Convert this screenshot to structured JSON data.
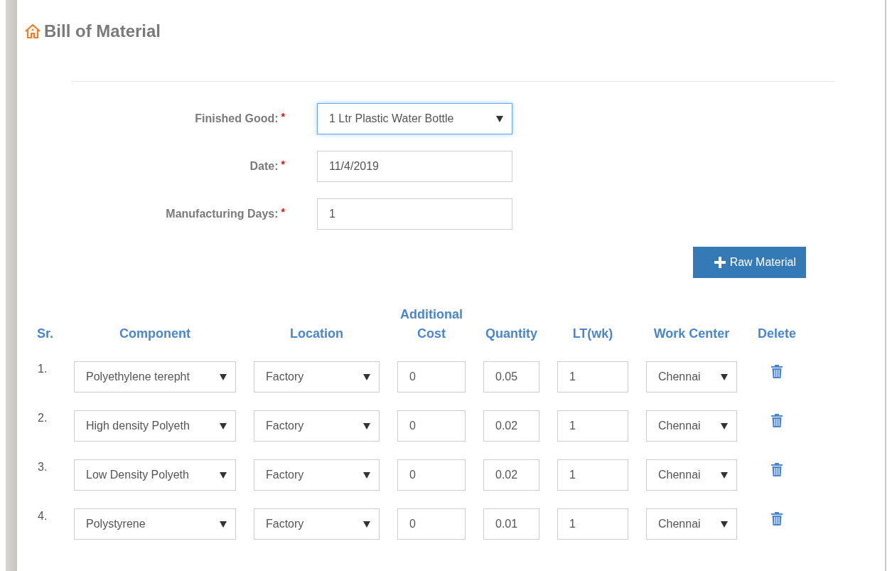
{
  "page": {
    "title": "Bill of Material"
  },
  "form": {
    "fields": [
      {
        "kind": "select",
        "label": "Finished Good:",
        "required_mark": "*",
        "value": "1 Ltr Plastic Water Bottle",
        "focused": true
      },
      {
        "kind": "text",
        "label": "Date:",
        "required_mark": "*",
        "value": "11/4/2019",
        "focused": false
      },
      {
        "kind": "text",
        "label": "Manufacturing Days:",
        "required_mark": "*",
        "value": "1",
        "focused": false
      }
    ],
    "add_button": "Raw Material"
  },
  "table": {
    "columns": [
      "Sr.",
      "Component",
      "Location",
      "Additional Cost",
      "Quantity",
      "LT(wk)",
      "Work Center",
      "Delete"
    ],
    "rows": [
      {
        "sr": "1.",
        "component": "Polyethylene terepht",
        "location": "Factory",
        "additional_cost": "0",
        "quantity": "0.05",
        "lt_wk": "1",
        "work_center": "Chennai"
      },
      {
        "sr": "2.",
        "component": "High density Polyeth",
        "location": "Factory",
        "additional_cost": "0",
        "quantity": "0.02",
        "lt_wk": "1",
        "work_center": "Chennai"
      },
      {
        "sr": "3.",
        "component": "Low Density Polyeth",
        "location": "Factory",
        "additional_cost": "0",
        "quantity": "0.02",
        "lt_wk": "1",
        "work_center": "Chennai"
      },
      {
        "sr": "4.",
        "component": "Polystyrene",
        "location": "Factory",
        "additional_cost": "0",
        "quantity": "0.01",
        "lt_wk": "1",
        "work_center": "Chennai"
      }
    ]
  }
}
